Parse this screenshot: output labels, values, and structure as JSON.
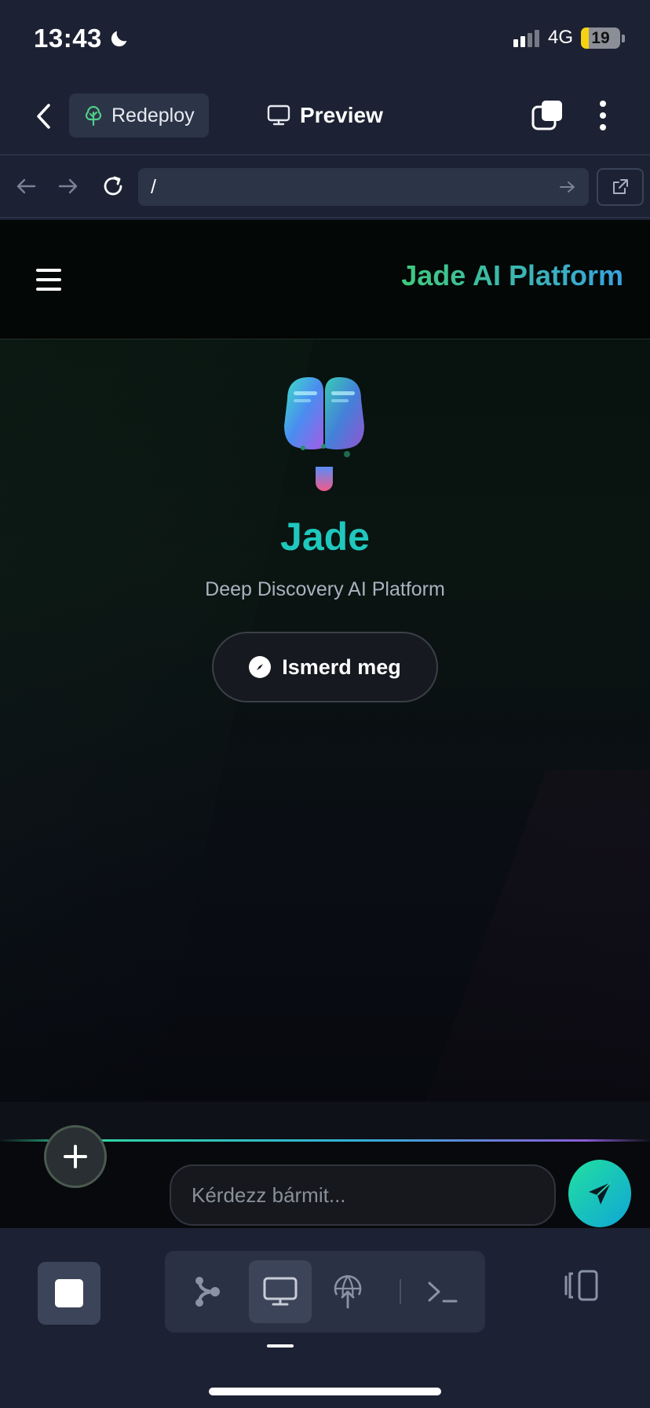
{
  "status_bar": {
    "time": "13:43",
    "network": "4G",
    "battery": "19",
    "battery_level": 0.19
  },
  "header": {
    "redeploy_label": "Redeploy",
    "preview_label": "Preview"
  },
  "browser": {
    "url": "/"
  },
  "site": {
    "brand": "Jade AI Platform",
    "hero_title": "Jade",
    "hero_subtitle": "Deep Discovery AI Platform",
    "cta_label": "Ismerd meg"
  },
  "chat": {
    "placeholder": "Kérdezz bármit..."
  },
  "colors": {
    "accent_teal": "#1fc7bd",
    "brand_green": "#3fca7c",
    "brand_blue": "#38a3e0",
    "battery_yellow": "#f5d313"
  },
  "icons": [
    "moon-icon",
    "cellular-signal-icon",
    "chevron-left-icon",
    "tree-icon",
    "monitor-icon",
    "tabs-icon",
    "more-vertical-icon",
    "arrow-left-icon",
    "arrow-right-icon",
    "reload-icon",
    "go-arrow-icon",
    "external-link-icon",
    "hamburger-menu-icon",
    "brain-logo-icon",
    "compass-icon",
    "plus-icon",
    "send-icon",
    "stop-icon",
    "branch-icon",
    "globe-upload-icon",
    "terminal-icon",
    "panel-toggle-icon"
  ]
}
